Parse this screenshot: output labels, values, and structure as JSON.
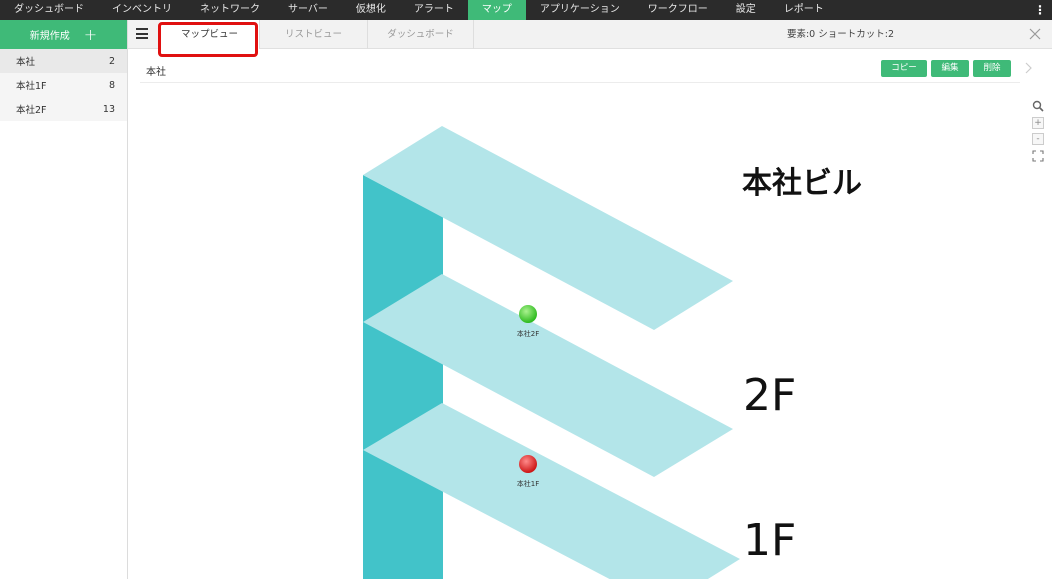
{
  "nav": {
    "items": [
      "ダッシュボード",
      "インベントリ",
      "ネットワーク",
      "サーバー",
      "仮想化",
      "アラート",
      "マップ",
      "アプリケーション",
      "ワークフロー",
      "設定",
      "レポート"
    ],
    "active": "マップ",
    "more": "⋮"
  },
  "sidebar": {
    "new_label": "新規作成",
    "new_icon": "+",
    "items": [
      {
        "label": "本社",
        "count": "2"
      },
      {
        "label": "本社1F",
        "count": "8"
      },
      {
        "label": "本社2F",
        "count": "13"
      }
    ]
  },
  "tabs": {
    "items": [
      "マップビュー",
      "リストビュー",
      "ダッシュボード"
    ],
    "active": "マップビュー",
    "counts": "要素:0  ショートカット:2"
  },
  "header": {
    "breadcrumb": "本社",
    "copy": "コピー",
    "edit": "編集",
    "delete": "削除"
  },
  "zoom": {
    "plus": "+",
    "minus": "-"
  },
  "map": {
    "title": "本社ビル",
    "floors": [
      "2F",
      "1F"
    ],
    "nodes": [
      {
        "label": "本社2F",
        "status": "up",
        "color": "#2ecc1a"
      },
      {
        "label": "本社1F",
        "status": "down",
        "color": "#e01010"
      }
    ]
  },
  "colors": {
    "accent": "#3fba78",
    "nav_bg": "#2b2b2b",
    "highlight": "#e01010",
    "floor_top": "#b3e5e9",
    "floor_side": "#42c3c9"
  }
}
